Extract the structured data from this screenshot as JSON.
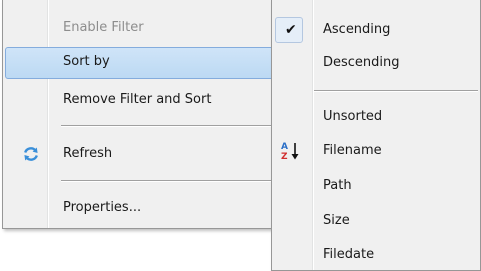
{
  "main_menu": {
    "items": [
      {
        "label": "Enable Filter"
      },
      {
        "label": "Sort by"
      },
      {
        "label": "Remove Filter and Sort"
      },
      {
        "label": "Refresh",
        "icon": "refresh-icon"
      },
      {
        "label": "Properties..."
      }
    ]
  },
  "sub_menu": {
    "items": [
      {
        "label": "Ascending",
        "checked": true
      },
      {
        "label": "Descending"
      },
      {
        "label": "Unsorted"
      },
      {
        "label": "Filename",
        "icon": "sort-az-icon"
      },
      {
        "label": "Path"
      },
      {
        "label": "Size"
      },
      {
        "label": "Filedate"
      }
    ]
  },
  "icons": {
    "refresh_color": "#3a8fd9",
    "sort_a_color": "#2b6fc7",
    "sort_z_color": "#d12f2f",
    "check_glyph": "✔",
    "arrow_glyph": "↓"
  }
}
